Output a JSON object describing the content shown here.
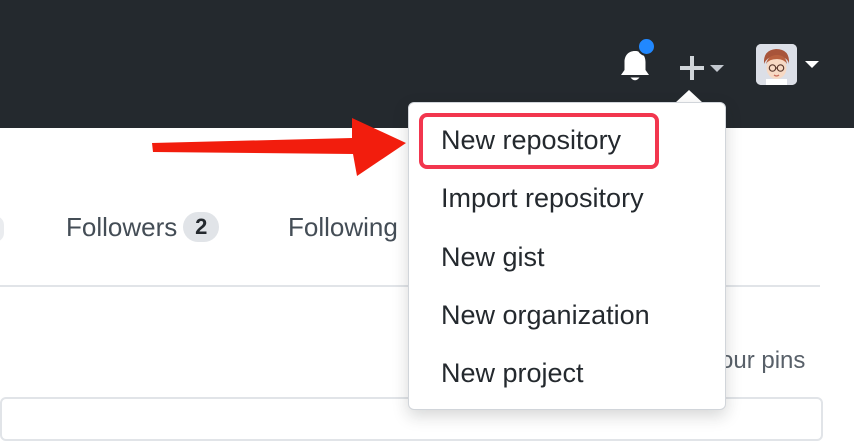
{
  "header": {
    "notification_dot_color": "#2188ff",
    "header_bg": "#24292e"
  },
  "profile_tabs": [
    {
      "label": "Followers",
      "count": "2"
    },
    {
      "label": "Following"
    }
  ],
  "pins_text": "your pins",
  "create_menu": {
    "items": [
      {
        "label": "New repository"
      },
      {
        "label": "Import repository"
      },
      {
        "label": "New gist"
      },
      {
        "label": "New organization"
      },
      {
        "label": "New project"
      }
    ],
    "highlight_color": "#f2364e",
    "highlighted_item": "New repository"
  },
  "annotation": {
    "arrow_color": "#f21d0d",
    "points_to": "New repository"
  }
}
